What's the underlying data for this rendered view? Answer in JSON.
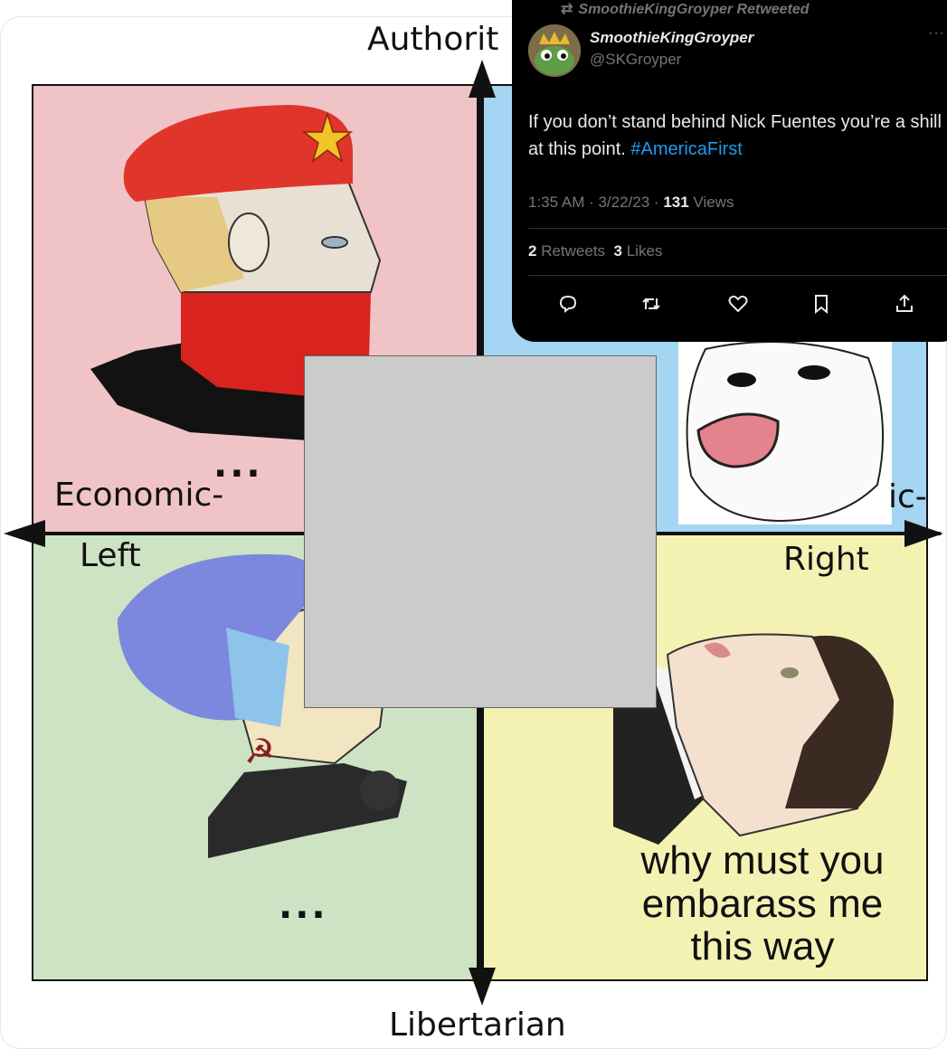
{
  "compass": {
    "top_label": "Authorit",
    "bottom_label": "Libertarian",
    "left_label_line1": "Economic-",
    "left_label_line2": "Left",
    "right_label_line1": "ic-",
    "right_label_line2": "Right",
    "dots_top": "...",
    "dots_bottom": "...",
    "meme_caption": "why must you embarass me this way",
    "colors": {
      "auth_left": "#f0c4c6",
      "auth_right": "#a4d5f2",
      "lib_left": "#cde3c3",
      "lib_right": "#f4f2b3",
      "center": "#cbcbcb"
    }
  },
  "tweet": {
    "retweet_line": "SmoothieKingGroyper Retweeted",
    "display_name": "SmoothieKingGroyper",
    "handle": "@SKGroyper",
    "more": "···",
    "text": "If you don’t stand behind Nick Fuentes you’re a shill at this point. ",
    "hashtag": "#AmericaFirst",
    "time": "1:35 AM · 3/22/23 · ",
    "views_count": "131",
    "views_label": " Views",
    "retweets_count": "2",
    "retweets_label": " Retweets  ",
    "likes_count": "3",
    "likes_label": " Likes",
    "icons": [
      "reply-icon",
      "retweet-icon",
      "like-icon",
      "bookmark-icon",
      "share-icon"
    ],
    "colors": {
      "background": "#000000",
      "hashtag": "#1d9bf0",
      "muted": "#71767b"
    }
  }
}
